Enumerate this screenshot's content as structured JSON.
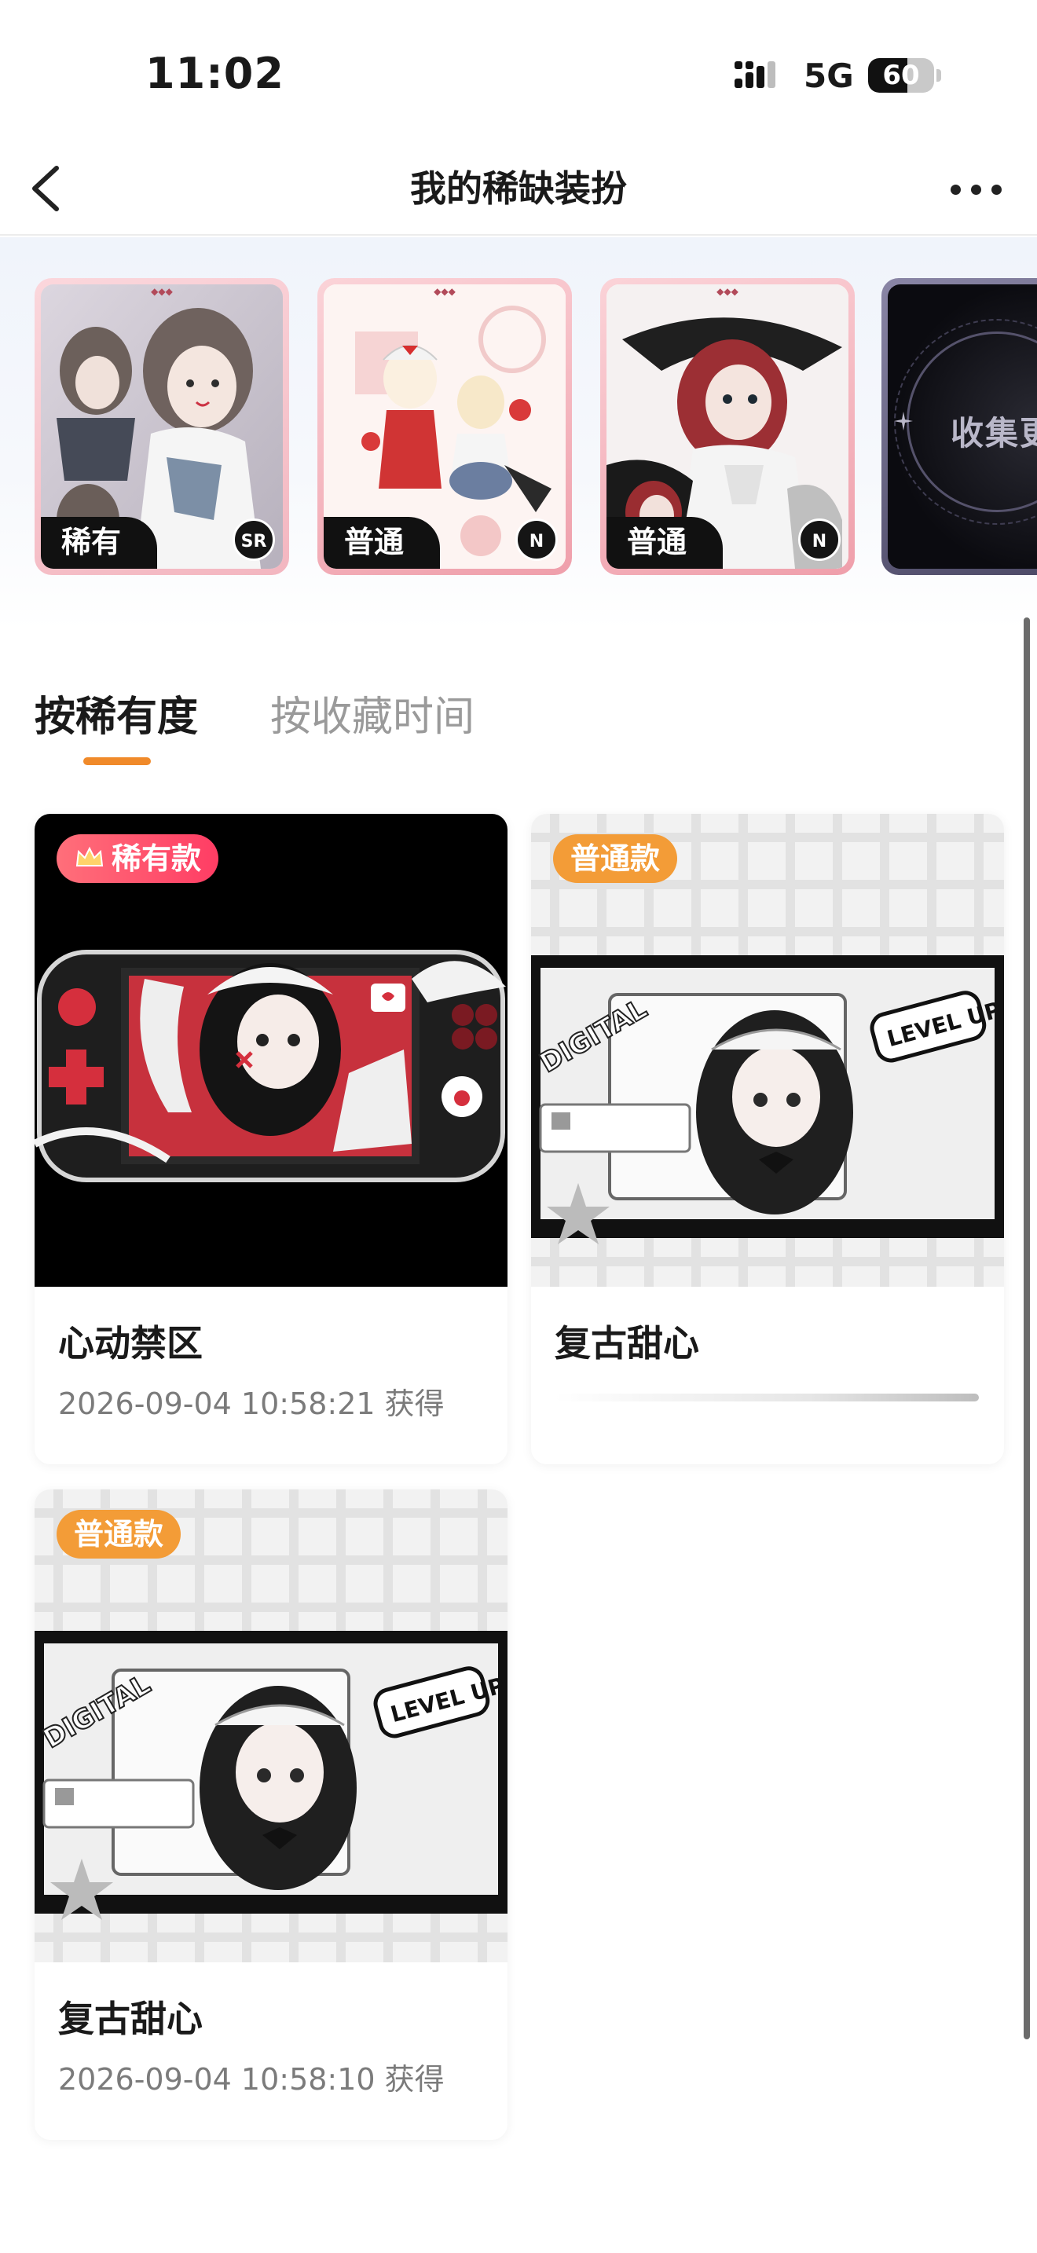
{
  "status_bar": {
    "time": "11:02",
    "network": "5G",
    "battery": "60",
    "battery_level": 0.6
  },
  "nav": {
    "title": "我的稀缺装扮"
  },
  "carousel": {
    "cards": [
      {
        "label": "稀有",
        "badge": "SR"
      },
      {
        "label": "普通",
        "badge": "N"
      },
      {
        "label": "普通",
        "badge": "N"
      }
    ],
    "more_label": "收集更"
  },
  "tabs": [
    {
      "label": "按稀有度",
      "active": true
    },
    {
      "label": "按收藏时间",
      "active": false
    }
  ],
  "items": [
    {
      "tag": "稀有款",
      "name": "心动禁区",
      "date": "2026-09-04 10:58:21 获得"
    },
    {
      "tag": "普通款",
      "name": "复古甜心",
      "date": ""
    },
    {
      "tag": "普通款",
      "name": "复古甜心",
      "date": "2026-09-04 10:58:10 获得"
    }
  ],
  "colors": {
    "accent": "#f08a2a",
    "rare_tag": "#ff4d6a",
    "normal_tag": "#f39c37"
  }
}
